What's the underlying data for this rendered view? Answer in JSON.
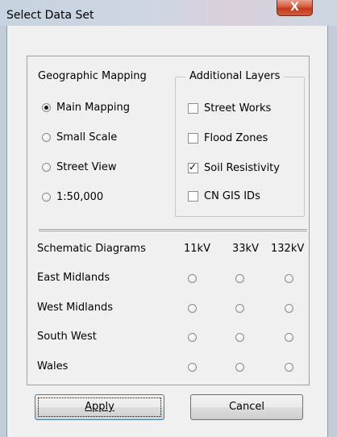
{
  "window": {
    "title": "Select Data Set",
    "close_glyph": "X"
  },
  "geographic_mapping": {
    "label": "Geographic Mapping",
    "options": [
      {
        "label": "Main Mapping",
        "selected": true
      },
      {
        "label": "Small Scale",
        "selected": false
      },
      {
        "label": "Street View",
        "selected": false
      },
      {
        "label": "1:50,000",
        "selected": false
      }
    ]
  },
  "additional_layers": {
    "label": "Additional Layers",
    "options": [
      {
        "label": "Street Works",
        "checked": false
      },
      {
        "label": "Flood Zones",
        "checked": false
      },
      {
        "label": "Soil Resistivity",
        "checked": true
      },
      {
        "label": "CN GIS IDs",
        "checked": false
      }
    ]
  },
  "schematic": {
    "label": "Schematic Diagrams",
    "columns": [
      "11kV",
      "33kV",
      "132kV"
    ],
    "rows": [
      "East Midlands",
      "West Midlands",
      "South West",
      "Wales"
    ]
  },
  "buttons": {
    "apply": "Apply",
    "cancel": "Cancel"
  }
}
